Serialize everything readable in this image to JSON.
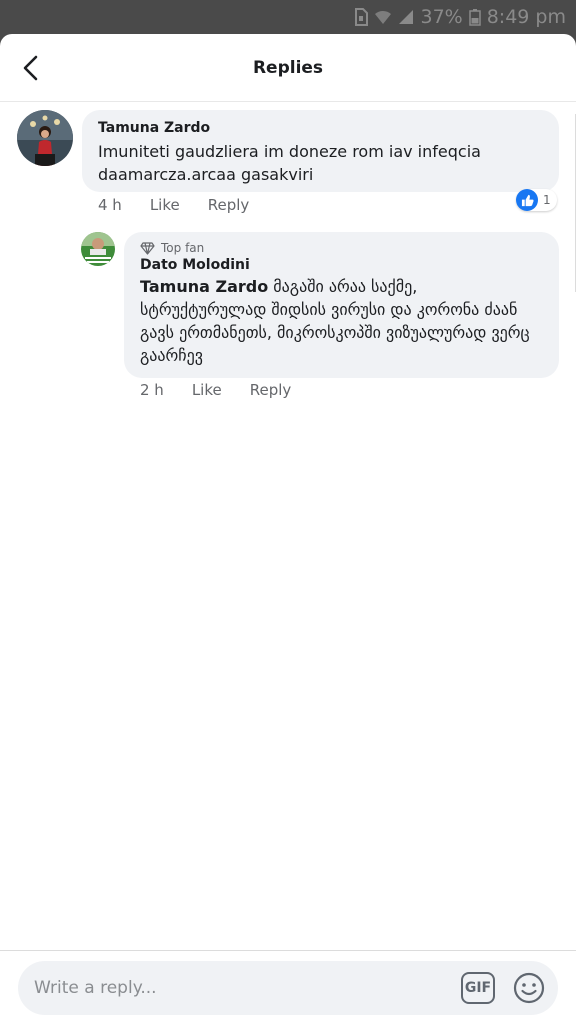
{
  "status_bar": {
    "battery": "37%",
    "time": "8:49 pm"
  },
  "header": {
    "title": "Replies"
  },
  "comment": {
    "author": "Tamuna Zardo",
    "text": "Imuniteti gaudzliera im doneze rom iav infeqcia daamarcza.arcaa gasakviri",
    "time": "4 h",
    "like_label": "Like",
    "reply_label": "Reply",
    "reaction_count": "1"
  },
  "reply": {
    "badge": "Top fan",
    "author": "Dato Molodini",
    "mention": "Tamuna Zardo",
    "text": "მაგაში არაა საქმე, სტრუქტურულად შიდსის ვირუსი და კორონა ძაან გავს ერთმანეთს, მიკროსკოპში ვიზუალურად ვერც გაარჩევ",
    "time": "2 h",
    "like_label": "Like",
    "reply_label": "Reply"
  },
  "composer": {
    "placeholder": "Write a reply...",
    "gif_label": "GIF"
  },
  "colors": {
    "accent": "#1877f2",
    "bubble": "#f0f2f5",
    "muted": "#65676b"
  }
}
